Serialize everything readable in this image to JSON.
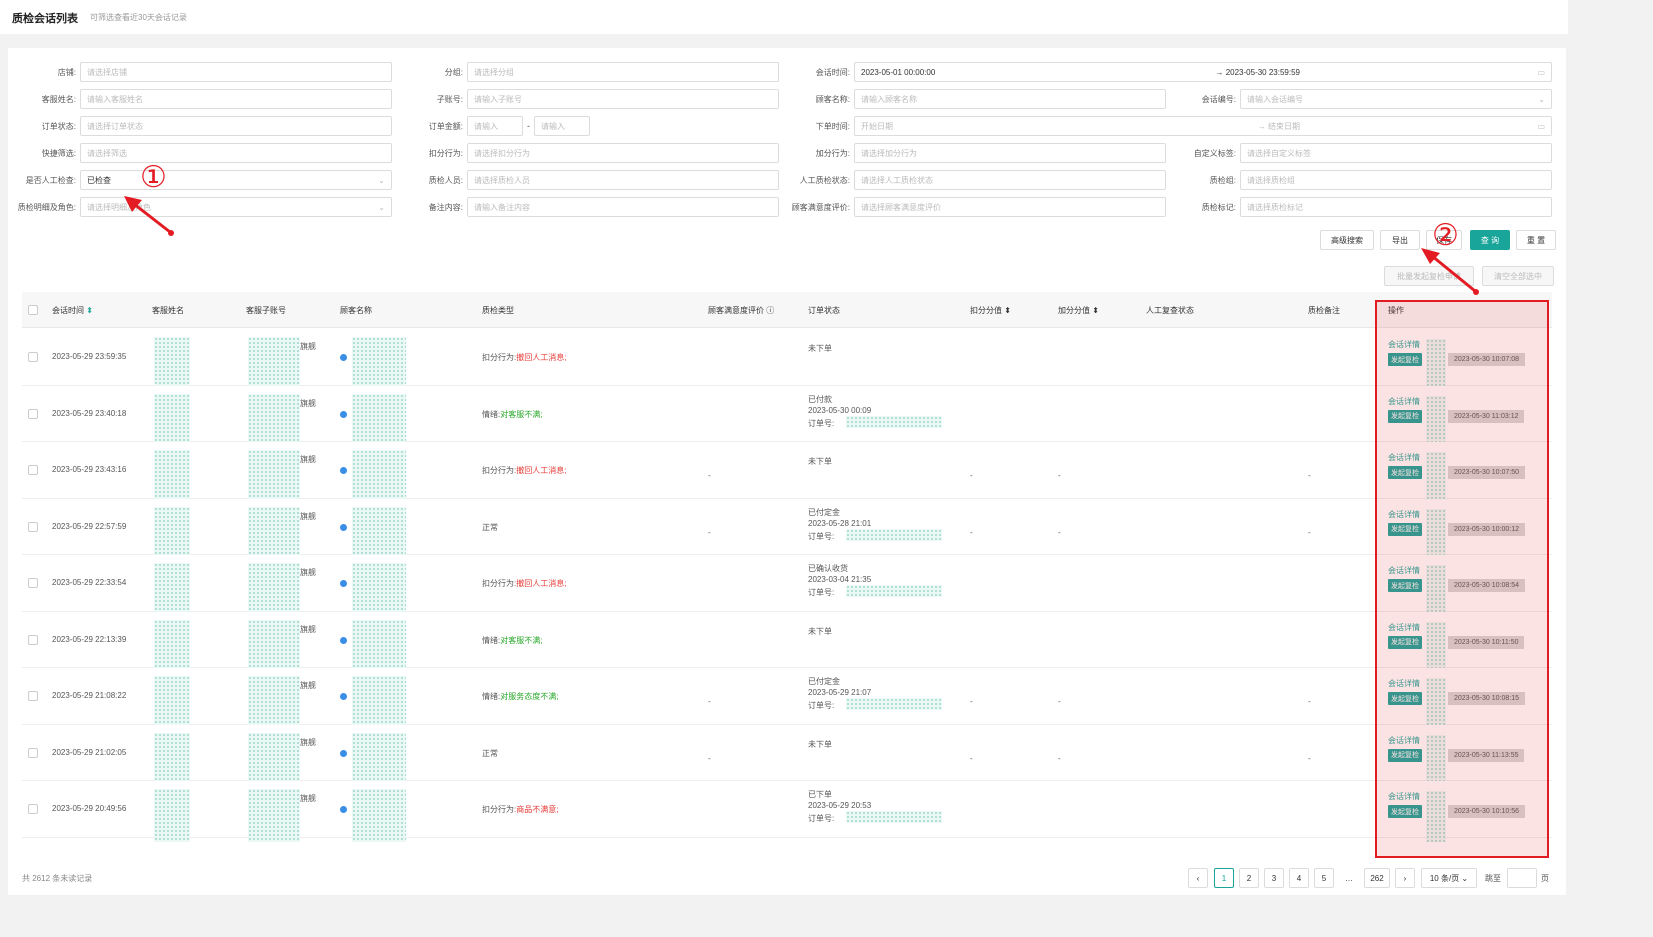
{
  "header": {
    "title": "质检会话列表",
    "subtitle": "可筛选查看近30天会话记录"
  },
  "filters": [
    {
      "label": "店铺:",
      "placeholder": "请选择店铺",
      "value": "",
      "arrow": ""
    },
    {
      "label": "分组:",
      "placeholder": "请选择分组",
      "value": "",
      "arrow": ""
    },
    {
      "label": "会话时间:",
      "value": "2023-05-01 00:00:00",
      "value2": "2023-05-30 23:59:59",
      "sep": "→",
      "arrow": "▭"
    },
    {
      "label": "客服姓名:",
      "placeholder": "请输入客服姓名",
      "value": "",
      "arrow": ""
    },
    {
      "label": "子账号:",
      "placeholder": "请输入子账号",
      "value": "",
      "arrow": ""
    },
    {
      "label": "顾客名称:",
      "placeholder": "请输入顾客名称",
      "value": "",
      "arrow": ""
    },
    {
      "label": "会话编号:",
      "placeholder": "请输入会话编号",
      "value": "",
      "arrow": "⌄"
    },
    {
      "label": "订单状态:",
      "placeholder": "请选择订单状态",
      "value": "",
      "arrow": ""
    },
    {
      "label": "订单金额:",
      "placeholder": "请输入",
      "placeholder2": "请输入",
      "sep": "-",
      "value": ""
    },
    {
      "label": "下单时间:",
      "placeholder": "开始日期",
      "placeholder2": "结束日期",
      "sep": "→",
      "arrow": "▭"
    },
    {
      "label": "快捷筛选:",
      "placeholder": "请选择筛选",
      "value": "",
      "arrow": ""
    },
    {
      "label": "扣分行为:",
      "placeholder": "请选择扣分行为",
      "value": "",
      "arrow": ""
    },
    {
      "label": "加分行为:",
      "placeholder": "请选择加分行为",
      "value": "",
      "arrow": ""
    },
    {
      "label": "自定义标签:",
      "placeholder": "请选择自定义标签",
      "value": "",
      "arrow": ""
    },
    {
      "label": "是否人工检查:",
      "placeholder": "",
      "value": "已检查",
      "arrow": "⌄"
    },
    {
      "label": "质检人员:",
      "placeholder": "请选择质检人员",
      "value": "",
      "arrow": ""
    },
    {
      "label": "人工质检状态:",
      "placeholder": "请选择人工质检状态",
      "value": "",
      "arrow": ""
    },
    {
      "label": "质检组:",
      "placeholder": "请选择质检组",
      "value": "",
      "arrow": ""
    },
    {
      "label": "质检明细及角色:",
      "placeholder": "请选择明细及角色",
      "value": "",
      "arrow": "⌄"
    },
    {
      "label": "备注内容:",
      "placeholder": "请输入备注内容",
      "value": "",
      "arrow": ""
    },
    {
      "label": "顾客满意度评价:",
      "placeholder": "请选择顾客满意度评价",
      "value": "",
      "arrow": ""
    },
    {
      "label": "质检标记:",
      "placeholder": "请选择质检标记",
      "value": "",
      "arrow": ""
    }
  ],
  "actions": {
    "advanced": "高级搜索",
    "export": "导出",
    "hidden": "保存",
    "query": "查 询",
    "reset": "重 置",
    "batch_recheck": "批量发起复检申请",
    "clear_all": "清空全部选中"
  },
  "columns": [
    "会话时间",
    "客服姓名",
    "客服子账号",
    "顾客名称",
    "质检类型",
    "顾客满意度评价",
    "订单状态",
    "扣分分值",
    "加分分值",
    "人工复查状态",
    "质检备注",
    "操作"
  ],
  "rows": [
    {
      "time": "2023-05-29 23:59:35",
      "acc_suffix": "旗舰",
      "quality": "扣分行为:",
      "quality_detail": "撤回人工消息;",
      "detail_color": "red",
      "satisfaction": "",
      "order": [
        "未下单"
      ],
      "deduct": "",
      "add": "",
      "manual": "",
      "note": "",
      "op_link": "会话详情",
      "op_tag": "发起复检",
      "op_time": "2023-05-30 10:07:08"
    },
    {
      "time": "2023-05-29 23:40:18",
      "acc_suffix": "旗舰",
      "quality": "情绪:",
      "quality_detail": "对客服不满;",
      "detail_color": "green",
      "satisfaction": "",
      "order": [
        "已付款",
        "2023-05-30 00:09",
        "订单号:"
      ],
      "deduct": "",
      "add": "",
      "manual": "",
      "note": "",
      "op_link": "会话详情",
      "op_tag": "发起复检",
      "op_time": "2023-05-30 11:03:12"
    },
    {
      "time": "2023-05-29 23:43:16",
      "acc_suffix": "旗舰",
      "quality": "扣分行为:",
      "quality_detail": "撤回人工消息;",
      "detail_color": "red",
      "satisfaction": "-",
      "order": [
        "未下单"
      ],
      "deduct": "-",
      "add": "-",
      "manual": "",
      "note": "-",
      "op_link": "会话详情",
      "op_tag": "发起复检",
      "op_time": "2023-05-30 10:07:50"
    },
    {
      "time": "2023-05-29 22:57:59",
      "acc_suffix": "旗舰",
      "quality": "正常",
      "quality_detail": "",
      "detail_color": "",
      "satisfaction": "-",
      "order": [
        "已付定金",
        "2023-05-28 21:01",
        "订单号:"
      ],
      "deduct": "-",
      "add": "-",
      "manual": "",
      "note": "-",
      "op_link": "会话详情",
      "op_tag": "发起复检",
      "op_time": "2023-05-30 10:00:12"
    },
    {
      "time": "2023-05-29 22:33:54",
      "acc_suffix": "旗舰",
      "quality": "扣分行为:",
      "quality_detail": "撤回人工消息;",
      "detail_color": "red",
      "satisfaction": "",
      "order": [
        "已确认收货",
        "2023-03-04 21:35",
        "订单号:"
      ],
      "deduct": "",
      "add": "",
      "manual": "",
      "note": "",
      "op_link": "会话详情",
      "op_tag": "发起复检",
      "op_time": "2023-05-30 10:08:54"
    },
    {
      "time": "2023-05-29 22:13:39",
      "acc_suffix": "旗舰",
      "quality": "情绪:",
      "quality_detail": "对客服不满;",
      "detail_color": "green",
      "satisfaction": "",
      "order": [
        "未下单"
      ],
      "deduct": "",
      "add": "",
      "manual": "",
      "note": "",
      "op_link": "会话详情",
      "op_tag": "发起复检",
      "op_time": "2023-05-30 10:11:50"
    },
    {
      "time": "2023-05-29 21:08:22",
      "acc_suffix": "旗舰",
      "quality": "情绪:",
      "quality_detail": "对服务态度不满;",
      "detail_color": "green",
      "satisfaction": "-",
      "order": [
        "已付定金",
        "2023-05-29 21:07",
        "订单号:"
      ],
      "deduct": "-",
      "add": "-",
      "manual": "",
      "note": "-",
      "op_link": "会话详情",
      "op_tag": "发起复检",
      "op_time": "2023-05-30 10:08:15"
    },
    {
      "time": "2023-05-29 21:02:05",
      "acc_suffix": "旗舰",
      "quality": "正常",
      "quality_detail": "",
      "detail_color": "",
      "satisfaction": "-",
      "order": [
        "未下单"
      ],
      "deduct": "-",
      "add": "-",
      "manual": "",
      "note": "-",
      "op_link": "会话详情",
      "op_tag": "发起复检",
      "op_time": "2023-05-30 11:13:55"
    },
    {
      "time": "2023-05-29 20:49:56",
      "acc_suffix": "旗舰",
      "quality": "扣分行为:",
      "quality_detail": "商品不满意;",
      "detail_color": "red",
      "satisfaction": "",
      "order": [
        "已下单",
        "2023-05-29 20:53",
        "订单号:"
      ],
      "deduct": "",
      "add": "",
      "manual": "",
      "note": "",
      "op_link": "会话详情",
      "op_tag": "发起复检",
      "op_time": "2023-05-30 10:10:56"
    }
  ],
  "footer": {
    "total": "共 2612 条未读记录",
    "pages": [
      "1",
      "2",
      "3",
      "4",
      "5",
      "…",
      "262"
    ],
    "prev": "‹",
    "next": "›",
    "page_size": "10 条/页",
    "goto_label": "跳至",
    "goto_suffix": "页"
  },
  "annotations": {
    "one": "①",
    "two": "②",
    "color": "#e31b23"
  },
  "colors": {
    "accent": "#1aa59b",
    "red": "#e53935",
    "green": "#27a727"
  }
}
